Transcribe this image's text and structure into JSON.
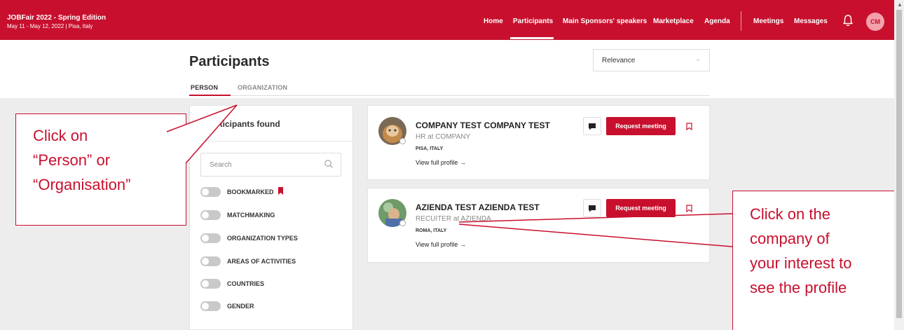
{
  "event": {
    "title": "JOBFair 2022 - Spring Edition",
    "subtitle": "May 11 - May 12, 2022 | Pisa, Italy"
  },
  "nav": {
    "items": [
      "Home",
      "Participants",
      "Main Sponsors' speakers",
      "Marketplace",
      "Agenda",
      "Meetings",
      "Messages"
    ],
    "active": "Participants",
    "avatar_initials": "CM"
  },
  "page": {
    "title": "Participants",
    "tabs": [
      "PERSON",
      "ORGANIZATION"
    ],
    "sort_select": "Relevance"
  },
  "filters": {
    "found_text": "2 participants found",
    "search_placeholder": "Search",
    "toggles": [
      "BOOKMARKED",
      "MATCHMAKING",
      "ORGANIZATION TYPES",
      "AREAS OF ACTIVITIES",
      "COUNTRIES",
      "GENDER"
    ]
  },
  "participants": [
    {
      "name": "COMPANY TEST COMPANY TEST",
      "role": "HR at COMPANY",
      "location": "PISA, ITALY",
      "link": "View full profile →",
      "request_label": "Request meeting"
    },
    {
      "name": "AZIENDA TEST AZIENDA TEST",
      "role": "RECUITER at AZIENDA",
      "location": "ROMA, ITALY",
      "link": "View full profile →",
      "request_label": "Request meeting"
    }
  ],
  "annotations": {
    "left_lines": [
      "Click on",
      "“Person” or",
      "“Organisation”"
    ],
    "right_lines": [
      "Click on the",
      "company of",
      "your interest to",
      "see the profile"
    ]
  },
  "colors": {
    "brand": "#c8102e",
    "background": "#ededed"
  }
}
